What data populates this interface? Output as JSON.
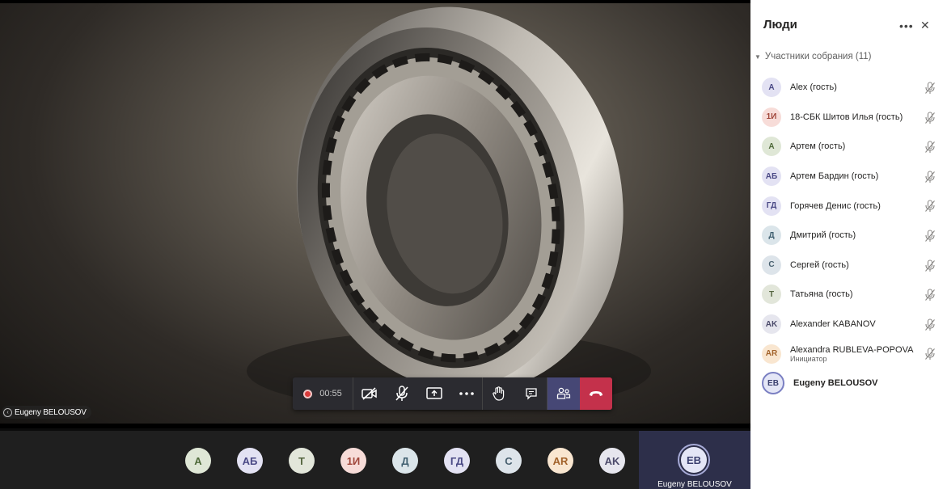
{
  "stage": {
    "presenter_name": "Eugeny BELOUSOV"
  },
  "controls": {
    "timer": "00:55",
    "icons": [
      "record-icon",
      "camera-off-icon",
      "mic-off-icon",
      "share-screen-icon",
      "more-icon",
      "raise-hand-icon",
      "chat-icon",
      "people-icon",
      "hang-up-icon"
    ],
    "colors": {
      "bar": "#2b2b30",
      "people_active": "#464775",
      "hangup": "#c4314b",
      "record": "#d83b3b"
    }
  },
  "strip": {
    "avatars": [
      {
        "initials": "A",
        "bg": "#dfe7d6",
        "fg": "#4f6a3a"
      },
      {
        "initials": "АБ",
        "bg": "#e3e2f3",
        "fg": "#4b4a86"
      },
      {
        "initials": "Т",
        "bg": "#e2e6da",
        "fg": "#54643f"
      },
      {
        "initials": "1И",
        "bg": "#f7dcd8",
        "fg": "#a0463a"
      },
      {
        "initials": "Д",
        "bg": "#dbe5ea",
        "fg": "#3f5f70"
      },
      {
        "initials": "ГД",
        "bg": "#e3e2f3",
        "fg": "#4b4a86"
      },
      {
        "initials": "С",
        "bg": "#dde4ea",
        "fg": "#48606f"
      },
      {
        "initials": "AR",
        "bg": "#f9e6d0",
        "fg": "#a2622a"
      },
      {
        "initials": "AK",
        "bg": "#e6e6ee",
        "fg": "#4b4a6a"
      }
    ],
    "self": {
      "initials": "EB",
      "name": "Eugeny BELOUSOV"
    }
  },
  "panel": {
    "title": "Люди",
    "section_label": "Участники собрания (11)",
    "participants": [
      {
        "initials": "A",
        "name": "Alex (гость)",
        "bg": "#e3e2f3",
        "fg": "#4b4a86"
      },
      {
        "initials": "1И",
        "name": "18-СБК Шитов Илья (гость)",
        "bg": "#f7dcd8",
        "fg": "#a0463a"
      },
      {
        "initials": "А",
        "name": "Артем (гость)",
        "bg": "#dfe7d6",
        "fg": "#4f6a3a"
      },
      {
        "initials": "АБ",
        "name": "Артем Бардин (гость)",
        "bg": "#e3e2f3",
        "fg": "#4b4a86"
      },
      {
        "initials": "ГД",
        "name": "Горячев Денис (гость)",
        "bg": "#e3e2f3",
        "fg": "#4b4a86"
      },
      {
        "initials": "Д",
        "name": "Дмитрий (гость)",
        "bg": "#dbe5ea",
        "fg": "#3f5f70"
      },
      {
        "initials": "С",
        "name": "Сергей (гость)",
        "bg": "#dde4ea",
        "fg": "#48606f"
      },
      {
        "initials": "Т",
        "name": "Татьяна (гость)",
        "bg": "#e2e6da",
        "fg": "#54643f"
      },
      {
        "initials": "AK",
        "name": "Alexander KABANOV",
        "bg": "#e6e6ee",
        "fg": "#4b4a6a"
      },
      {
        "initials": "AR",
        "name": "Alexandra RUBLEVA-POPOVA",
        "sub": "Инициатор",
        "bg": "#f9e6d0",
        "fg": "#a2622a"
      },
      {
        "initials": "EB",
        "name": "Eugeny BELOUSOV",
        "self": true
      }
    ]
  }
}
